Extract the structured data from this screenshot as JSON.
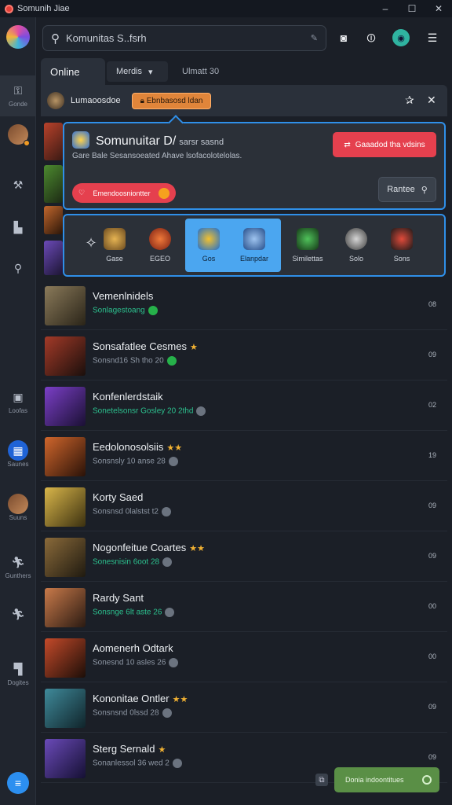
{
  "window": {
    "title": "Somunih Jiae",
    "controls": [
      "–",
      "☐",
      "✕"
    ]
  },
  "rail": {
    "items": [
      {
        "label": "Gonde",
        "icon": "lock-icon"
      },
      {
        "label": "",
        "icon": "avatar"
      },
      {
        "label": "",
        "icon": "hammer-icon"
      },
      {
        "label": "",
        "icon": "boot-icon"
      },
      {
        "label": "",
        "icon": "pin-icon"
      },
      {
        "label": "Loofas",
        "icon": "box-icon"
      },
      {
        "label": "Saunes",
        "icon": "grid-icon"
      },
      {
        "label": "Suuns",
        "icon": "avatar"
      },
      {
        "label": "Gunthers",
        "icon": "runner-icon"
      },
      {
        "label": "",
        "icon": "runner-icon"
      },
      {
        "label": "Dogites",
        "icon": "dog-icon"
      }
    ]
  },
  "search": {
    "value": "Komunitas S..fsrh"
  },
  "tabs": {
    "online": "Online",
    "dropdown": "Merdis",
    "third": "Ulmatt  30"
  },
  "infobar": {
    "label": "Lumaoosdoe",
    "pill": "Ebnbasosd ldan"
  },
  "popup": {
    "title": "Somunuitar D/",
    "title_sub": "sarsr sasnd",
    "desc": "Gare   Bale  Sesansoeated  Ahave  lsofacolotelolas.",
    "red_button": "Gaaadod tha vdsins",
    "red_pill": "Emendoosniontter",
    "grey_button": "Rantee"
  },
  "categories": [
    {
      "label": "Gase"
    },
    {
      "label": "EGEO"
    },
    {
      "label": "Gos"
    },
    {
      "label": "Elanpdar"
    },
    {
      "label": "Similettas"
    },
    {
      "label": "Solo"
    },
    {
      "label": "Sons"
    }
  ],
  "list": [
    {
      "title": "Vemenlnidels",
      "stars": "",
      "sub": "Sonlagestoang",
      "sub_green": true,
      "badge": "g",
      "count": "08"
    },
    {
      "title": "Sonsafatlee Cesmes",
      "stars": "★",
      "sub": "Sonsnd16 Sh tho 20",
      "sub_green": false,
      "badge": "g",
      "count": "09"
    },
    {
      "title": "Konfenlerdstaik",
      "stars": "",
      "sub": "Sonetelsonsr Gosley 20 2thd",
      "sub_green": true,
      "badge": "n",
      "count": "02"
    },
    {
      "title": "Eedolonosolsiis",
      "stars": "★★",
      "sub": "Sonsnsly 10 anse 28",
      "sub_green": false,
      "badge": "n",
      "count": "19"
    },
    {
      "title": "Korty Saed",
      "stars": "",
      "sub": "Sonsnsd 0lalstst t2",
      "sub_green": false,
      "badge": "n",
      "count": "09"
    },
    {
      "title": "Nogonfeitue Coartes",
      "stars": "★★",
      "sub": "Sonesnisin 6oot 28",
      "sub_green": true,
      "badge": "n",
      "count": "09"
    },
    {
      "title": "Rardy Sant",
      "stars": "",
      "sub": "Sonsnge 6lt aste 26",
      "sub_green": true,
      "badge": "n",
      "count": "00"
    },
    {
      "title": "Aomenerh Odtark",
      "stars": "",
      "sub": "Sonesnd 10 asles 26",
      "sub_green": false,
      "badge": "n",
      "count": "00"
    },
    {
      "title": "Kononitae Ontler",
      "stars": "★★",
      "sub": "Sonsnsnd 0lssd 28",
      "sub_green": false,
      "badge": "n",
      "count": "09"
    },
    {
      "title": "Sterg Sernald",
      "stars": "★",
      "sub": "Sonanlessol 36 wed 2",
      "sub_green": false,
      "badge": "n",
      "count": "09"
    }
  ],
  "toast": {
    "label": "Donia indoontitues"
  },
  "colors": {
    "accent": "#2f8fe8",
    "danger": "#e5404e",
    "success": "#5a8f46",
    "warning": "#e0853a",
    "star": "#f2b233"
  }
}
